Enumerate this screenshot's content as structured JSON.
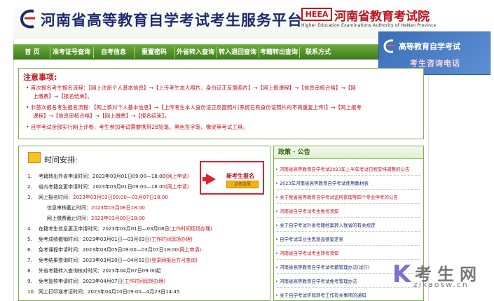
{
  "header": {
    "site_title": "河南省高等教育自学考试考生服务平台",
    "edu_badge": "HEEA",
    "edu_name": "河南省教育考试院",
    "edu_en": "Higher Education Examinations Authority of HeNan Province"
  },
  "nav": [
    "首 页",
    "准考证号查询",
    "自考信息",
    "重置密码",
    "外省转入查询",
    "转入退回查询",
    "考籍转出查询",
    "联系方式"
  ],
  "ad": {
    "line1": "高等教育自学考试",
    "line2": "考生咨询电话"
  },
  "notice": {
    "title": "注意事项:",
    "lines": [
      "• 首次报名考生报名流程：【网上注册个人基本信息】→【上传考生本人照片、身份证正反面照片】→【网上报课程】→【信息审核合格】→【网",
      "上缴费】→【报名结束】。",
      "• 非首次报名考生报名流程：【网上核对个人基本信息】→【上传考生本人身份证正反面照片(系统已有身份证照片的不再重复上传)】→【网上报考",
      "课程】→【信息审核合格】→【网上缴费】→【报名结束】。",
      "• 自学考试全部实行网上评卷，考生参加考试需要携带2B铅笔、黑色签字笔、橡皮等考试工具。"
    ]
  },
  "schedule": {
    "title": "时间安排:",
    "rows": [
      {
        "n": "1.",
        "label": "考籍转出外省申请时间：",
        "time": "2023年03月01日09:00—18:00",
        "extra": "(网上申请)"
      },
      {
        "n": "2.",
        "label": "省内考籍变更申请时间：",
        "time": "2023年03月01日09:00—18:00",
        "extra": "(网上申请)"
      },
      {
        "n": "3.",
        "label": "网上报名时间：",
        "time": "2023年03月03日09:00—03月07日18:00",
        "extra": ""
      },
      {
        "n": "",
        "label": "信息审核截止时间：",
        "time": "2023年03月08日18:00",
        "extra": ""
      },
      {
        "n": "",
        "label": "网上缴费截止时间：",
        "time": "2023年03月09日18:00",
        "extra": ""
      },
      {
        "n": "4.",
        "label": "在籍考生信息更正申请时间：",
        "time": "2023年03月01日—03月08日",
        "extra": "(工作时间现场办理)"
      },
      {
        "n": "5.",
        "label": "免考成绩撤销时间：",
        "time": "2023年03月01日—03月03日",
        "extra": "(工作时间现场办理)"
      },
      {
        "n": "6.",
        "label": "免考课程申请时间：",
        "time": "2023年03月05日09:00—03月07日18:00",
        "extra": "(网上申请)"
      },
      {
        "n": "7.",
        "label": "免考结果查询时间：",
        "time": "2023年03月20日—04月02日",
        "extra": "(登录网报后方可查询)"
      },
      {
        "n": "8.",
        "label": "外省考籍转入查询核对时间：",
        "time": "2023年04月07日09:00起",
        "extra": ""
      },
      {
        "n": "9.",
        "label": "免考复核申请时间：",
        "time": "2023年04月07日",
        "extra": "(工作时间现场办理)"
      },
      {
        "n": "10.",
        "label": "网上打印准考证时间：",
        "time": "2023年04月10日09:00—4月23日14:45",
        "extra": ""
      }
    ]
  },
  "new_reg": {
    "label": "新考生报名",
    "button": "点击这里"
  },
  "policy": {
    "title": "政策 · 公告",
    "items": [
      {
        "text": "河南省高等教育自学考试2023年上半年考试日程安排调整的公告",
        "red": true
      },
      {
        "text": "2023年河南省高等教育自学考试使用教材表",
        "red": false
      },
      {
        "text": "关于我省高等教育自学考试监所管理等四个专业停考的公告",
        "red": true
      },
      {
        "text": "河南省自学考试考生免考须知",
        "red": true
      },
      {
        "text": "关于自学考试外省考籍档案转入我省的有关规定",
        "red": false
      },
      {
        "text": "自学考试毕业生思想品德鉴定表",
        "red": false
      },
      {
        "text": "河南省自学考试考生转考须知",
        "red": true
      },
      {
        "text": "河南省高等教育自学考试考籍管理办法(试行)",
        "red": false
      },
      {
        "text": "河南省高等教育自学考试免考管理办法",
        "red": false
      },
      {
        "text": "关于自学考试实际转考工作有关事项的通知",
        "red": false
      }
    ]
  },
  "watermark": {
    "k": "K",
    "big": "考生网",
    "small": "zikaosw.cn"
  },
  "colors": {
    "brand_green": "#4f8f28",
    "alert_red": "#c2121e",
    "title_navy": "#1d2a70"
  }
}
